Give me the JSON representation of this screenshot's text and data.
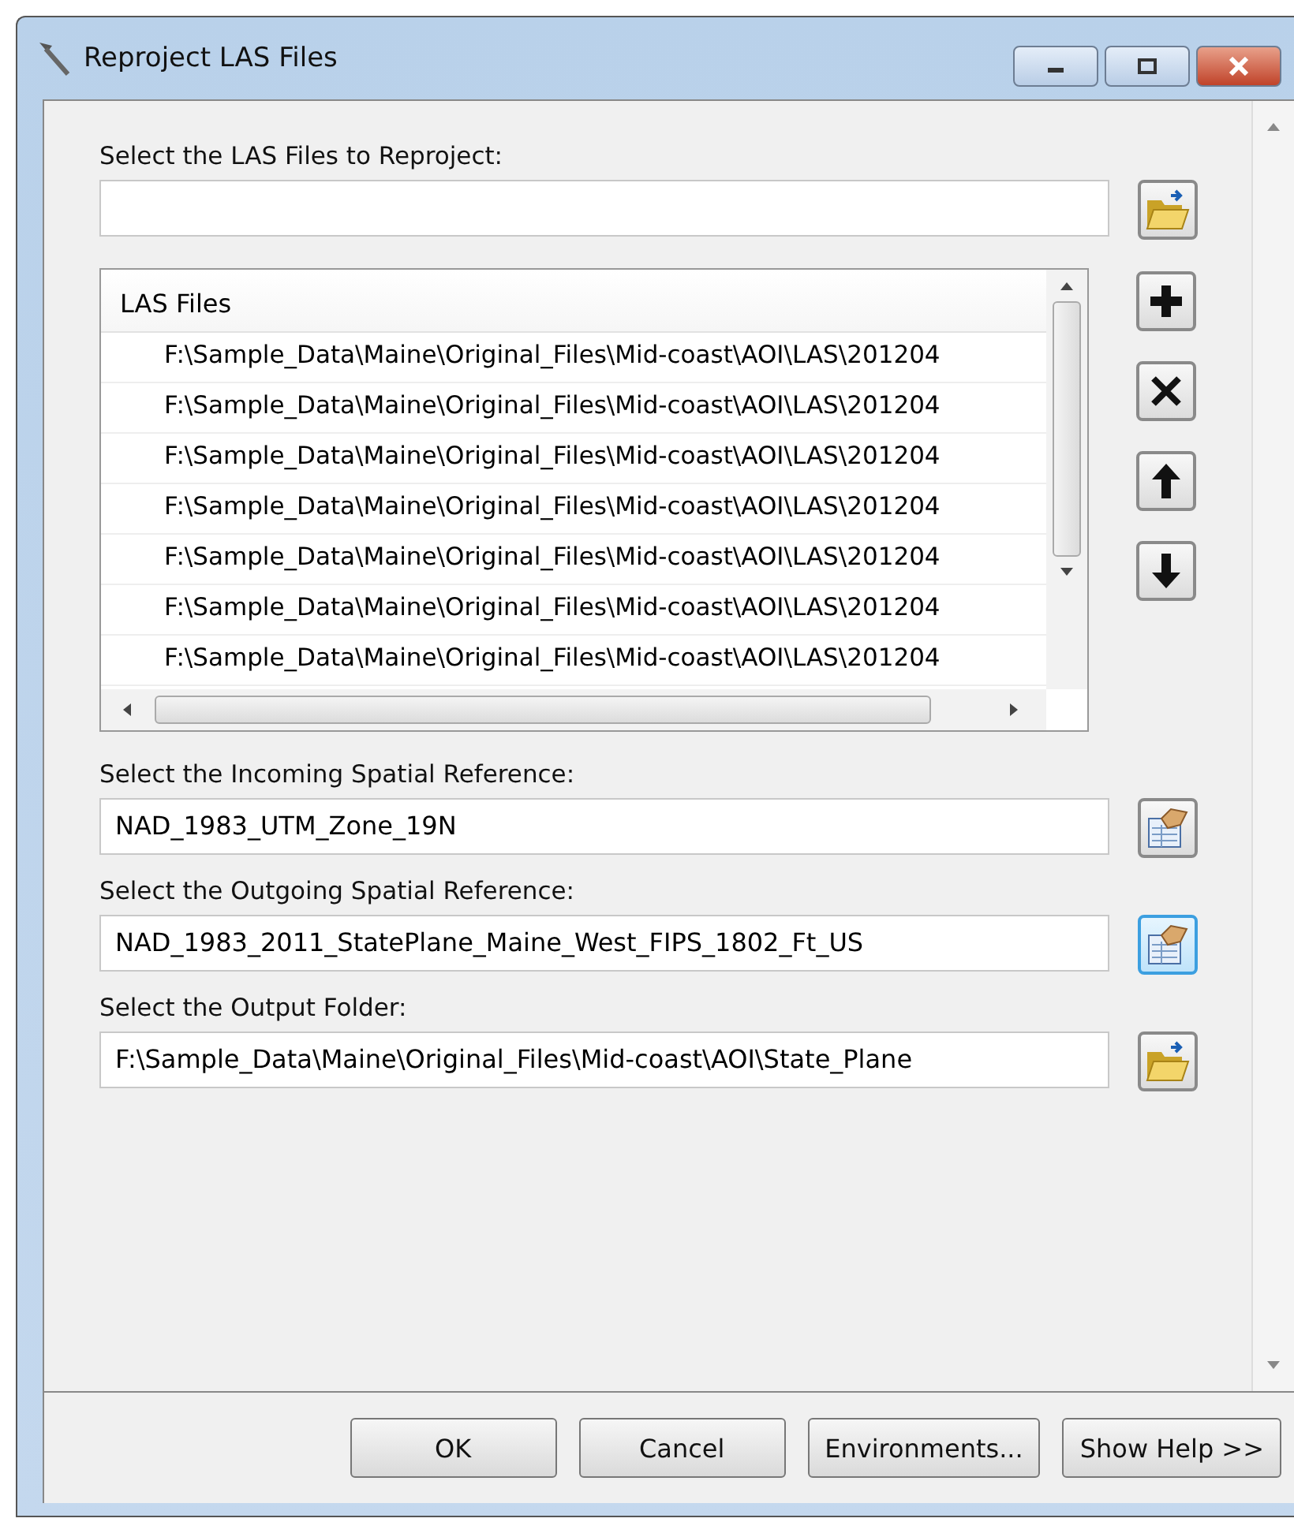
{
  "window": {
    "title": "Reproject LAS Files"
  },
  "sections": [
    {
      "kind": "input",
      "label": "Select the LAS Files to Reproject:",
      "button": {
        "kind": "folder",
        "highlighted": false
      }
    },
    {
      "kind": "list",
      "header": "LAS Files",
      "rows": [
        "F:\\Sample_Data\\Maine\\Original_Files\\Mid-coast\\AOI\\LAS\\201204",
        "F:\\Sample_Data\\Maine\\Original_Files\\Mid-coast\\AOI\\LAS\\201204",
        "F:\\Sample_Data\\Maine\\Original_Files\\Mid-coast\\AOI\\LAS\\201204",
        "F:\\Sample_Data\\Maine\\Original_Files\\Mid-coast\\AOI\\LAS\\201204",
        "F:\\Sample_Data\\Maine\\Original_Files\\Mid-coast\\AOI\\LAS\\201204",
        "F:\\Sample_Data\\Maine\\Original_Files\\Mid-coast\\AOI\\LAS\\201204",
        "F:\\Sample_Data\\Maine\\Original_Files\\Mid-coast\\AOI\\LAS\\201204"
      ]
    },
    {
      "kind": "input",
      "label": "Select the Incoming Spatial Reference:",
      "value": "NAD_1983_UTM_Zone_19N",
      "button": {
        "kind": "spatial",
        "highlighted": false
      }
    },
    {
      "kind": "input",
      "label": "Select the Outgoing Spatial Reference:",
      "value": "NAD_1983_2011_StatePlane_Maine_West_FIPS_1802_Ft_US",
      "button": {
        "kind": "spatial",
        "highlighted": true
      }
    },
    {
      "kind": "input",
      "label": "Select the Output Folder:",
      "value": "F:\\Sample_Data\\Maine\\Original_Files\\Mid-coast\\AOI\\State_Plane",
      "button": {
        "kind": "folder",
        "highlighted": false
      }
    }
  ],
  "buttons": [
    "OK",
    "Cancel",
    "Environments...",
    "Show Help >>"
  ]
}
